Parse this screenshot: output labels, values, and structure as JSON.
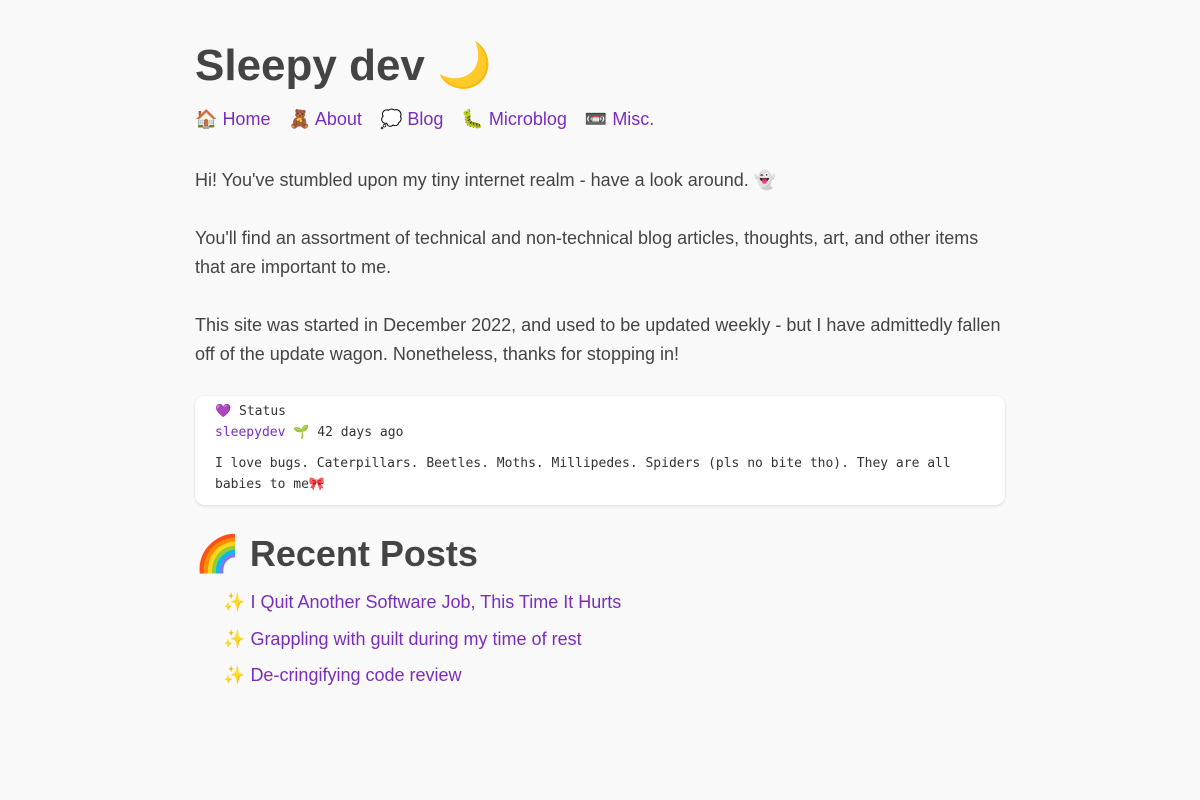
{
  "header": {
    "title": "Sleepy dev",
    "title_emoji": "🌙"
  },
  "nav": {
    "items": [
      {
        "emoji": "🏠",
        "label": "Home"
      },
      {
        "emoji": "🧸",
        "label": "About"
      },
      {
        "emoji": "💭",
        "label": "Blog"
      },
      {
        "emoji": "🐛",
        "label": "Microblog"
      },
      {
        "emoji": "📼",
        "label": "Misc."
      }
    ]
  },
  "intro": {
    "p1": "Hi! You've stumbled upon my tiny internet realm - have a look around. 👻",
    "p2": "You'll find an assortment of technical and non-technical blog articles, thoughts, art, and other items that are important to me.",
    "p3": "This site was started in December 2022, and used to be updated weekly - but I have admittedly fallen off of the update wagon. Nonetheless, thanks for stopping in!"
  },
  "status": {
    "heading_emoji": "💜",
    "heading": "Status",
    "user": "sleepydev",
    "user_emoji": "🌱",
    "time": "42 days ago",
    "text": "I love bugs. Caterpillars. Beetles. Moths. Millipedes. Spiders (pls no bite tho). They are all babies to me🎀"
  },
  "recent": {
    "title_emoji": "🌈",
    "title": "Recent Posts",
    "bullet": "✨",
    "posts": [
      "I Quit Another Software Job, This Time It Hurts",
      "Grappling with guilt during my time of rest",
      "De-cringifying code review"
    ]
  },
  "colors": {
    "link": "#7b2cbf",
    "text": "#444444",
    "background": "#f9f9f9",
    "card": "#ffffff"
  }
}
